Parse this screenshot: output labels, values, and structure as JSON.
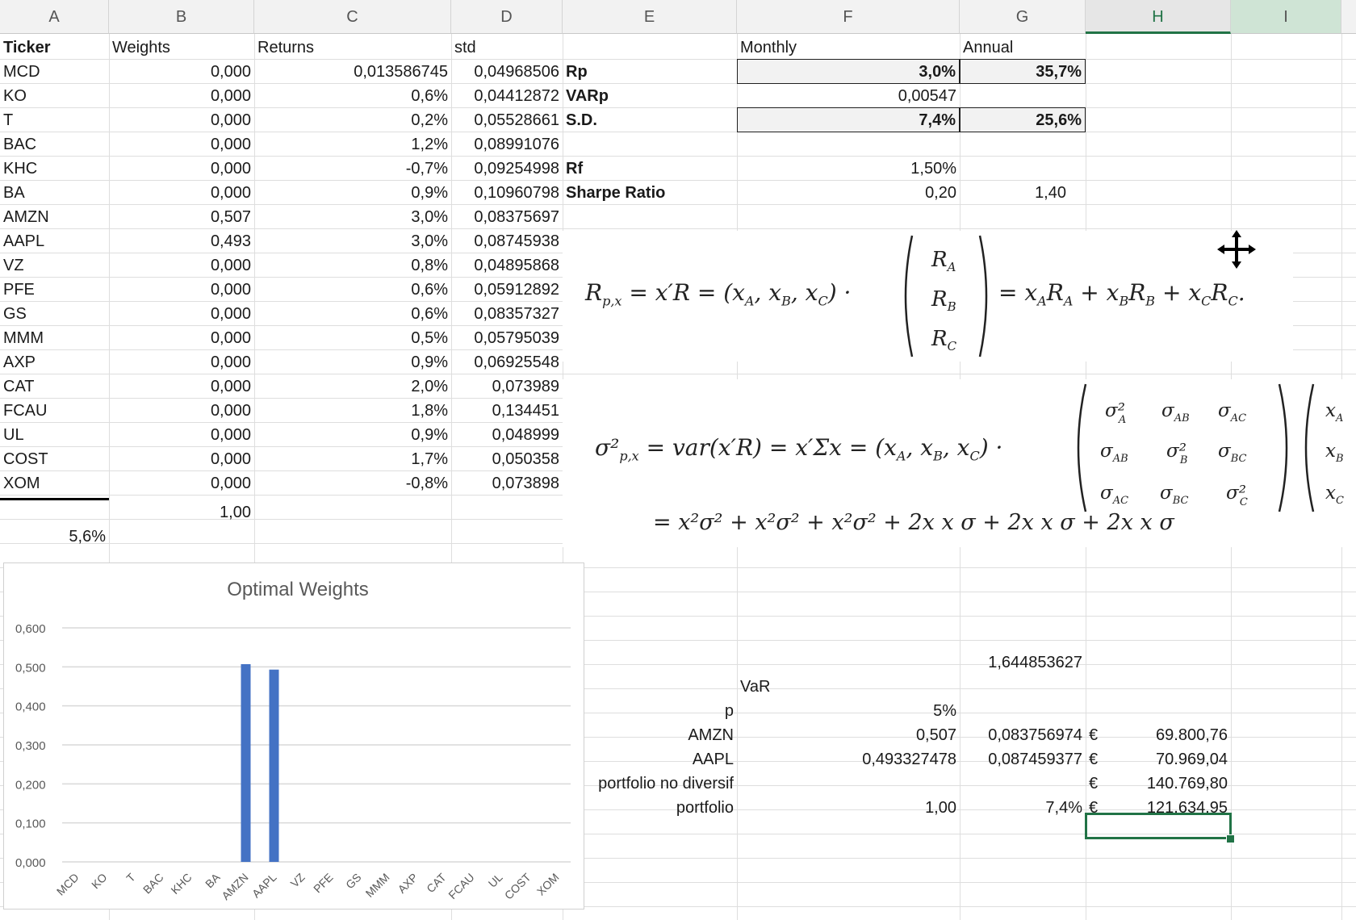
{
  "columns": [
    "A",
    "B",
    "C",
    "D",
    "E",
    "F",
    "G",
    "H",
    "I"
  ],
  "table": {
    "headers": [
      "Ticker",
      "Weights",
      "Returns",
      "std"
    ],
    "rows": [
      [
        "MCD",
        "0,000",
        "0,013586745",
        "0,04968506"
      ],
      [
        "KO",
        "0,000",
        "0,6%",
        "0,04412872"
      ],
      [
        "T",
        "0,000",
        "0,2%",
        "0,05528661"
      ],
      [
        "BAC",
        "0,000",
        "1,2%",
        "0,08991076"
      ],
      [
        "KHC",
        "0,000",
        "-0,7%",
        "0,09254998"
      ],
      [
        "BA",
        "0,000",
        "0,9%",
        "0,10960798"
      ],
      [
        "AMZN",
        "0,507",
        "3,0%",
        "0,08375697"
      ],
      [
        "AAPL",
        "0,493",
        "3,0%",
        "0,08745938"
      ],
      [
        "VZ",
        "0,000",
        "0,8%",
        "0,04895868"
      ],
      [
        "PFE",
        "0,000",
        "0,6%",
        "0,05912892"
      ],
      [
        "GS",
        "0,000",
        "0,6%",
        "0,08357327"
      ],
      [
        "MMM",
        "0,000",
        "0,5%",
        "0,05795039"
      ],
      [
        "AXP",
        "0,000",
        "0,9%",
        "0,06925548"
      ],
      [
        "CAT",
        "0,000",
        "2,0%",
        "0,073989"
      ],
      [
        "FCAU",
        "0,000",
        "1,8%",
        "0,134451"
      ],
      [
        "UL",
        "0,000",
        "0,9%",
        "0,048999"
      ],
      [
        "COST",
        "0,000",
        "1,7%",
        "0,050358"
      ],
      [
        "XOM",
        "0,000",
        "-0,8%",
        "0,073898"
      ]
    ],
    "weights_sum": "1,00",
    "a_total": "5,6%"
  },
  "stats": {
    "monthly_header": "Monthly",
    "annual_header": "Annual",
    "rp_label": "Rp",
    "rp_monthly": "3,0%",
    "rp_annual": "35,7%",
    "varp_label": "VARp",
    "varp_monthly": "0,00547",
    "sd_label": "S.D.",
    "sd_monthly": "7,4%",
    "sd_annual": "25,6%",
    "rf_label": "Rf",
    "rf_monthly": "1,50%",
    "sharpe_label": "Sharpe Ratio",
    "sharpe_monthly": "0,20",
    "sharpe_annual": "1,40"
  },
  "formulas": {
    "f1_lhs": "R",
    "f1_mid": " = x′R = (x",
    "f1_rhs": "= x_A R_A + x_B R_B + x_C R_C.",
    "f2_lhs": "σ²",
    "f2_mid": "=  var(x′R) = x′Σx = (x",
    "f2_line2": "= x²σ² + x²σ² + x²σ² + 2x x σ + 2x x σ + 2x x σ"
  },
  "var": {
    "z_value": "1,644853627",
    "title": "VaR",
    "p_label": "p",
    "p_value": "5%",
    "amzn_label": "AMZN",
    "amzn_w": "0,507",
    "amzn_sd": "0,083756974",
    "amzn_cur": "€",
    "amzn_val": "69.800,76",
    "aapl_label": "AAPL",
    "aapl_w": "0,493327478",
    "aapl_sd": "0,087459377",
    "aapl_cur": "€",
    "aapl_val": "70.969,04",
    "nodiv_label": "portfolio no diversif",
    "nodiv_cur": "€",
    "nodiv_val": "140.769,80",
    "port_label": "portfolio",
    "port_w": "1,00",
    "port_sd": "7,4%",
    "port_cur": "€",
    "port_val": "121.634,95"
  },
  "chart_data": {
    "type": "bar",
    "title": "Optimal Weights",
    "categories": [
      "MCD",
      "KO",
      "T",
      "BAC",
      "KHC",
      "BA",
      "AMZN",
      "AAPL",
      "VZ",
      "PFE",
      "GS",
      "MMM",
      "AXP",
      "CAT",
      "FCAU",
      "UL",
      "COST",
      "XOM"
    ],
    "values": [
      0,
      0,
      0,
      0,
      0,
      0,
      0.507,
      0.493,
      0,
      0,
      0,
      0,
      0,
      0,
      0,
      0,
      0,
      0
    ],
    "yticks": [
      "0,000",
      "0,100",
      "0,200",
      "0,300",
      "0,400",
      "0,500",
      "0,600"
    ],
    "ylim": [
      0,
      0.6
    ],
    "bar_color": "#4472c4",
    "grid": true
  }
}
